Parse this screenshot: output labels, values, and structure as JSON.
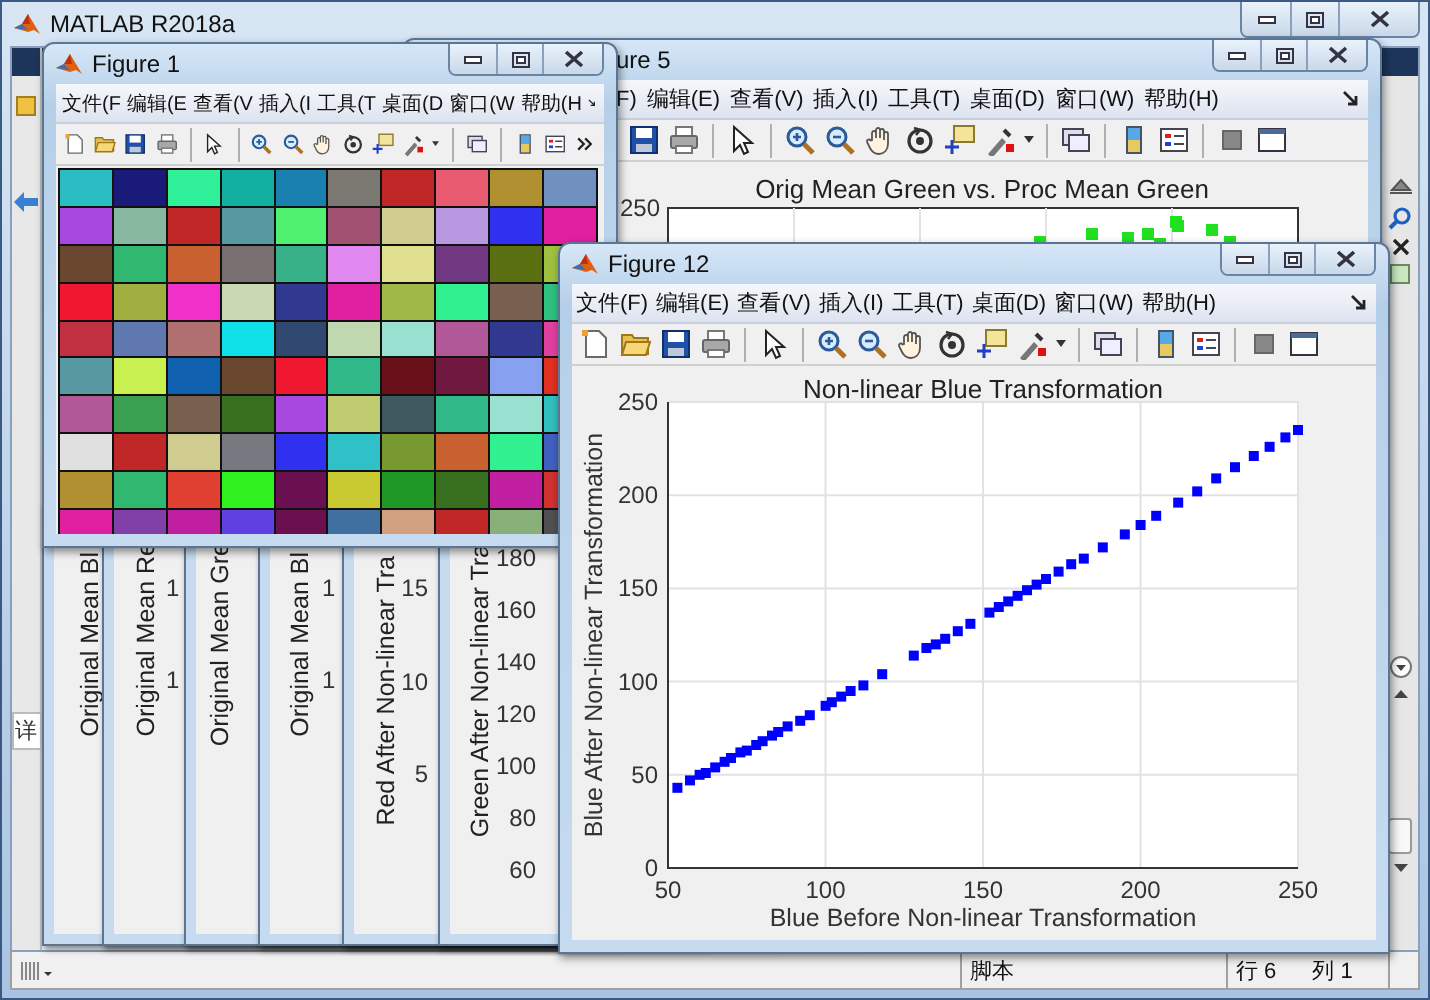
{
  "main_window": {
    "title": "MATLAB R2018a",
    "side_tab": "详"
  },
  "figure_5": {
    "title": "ure 5",
    "menus": [
      "F)",
      "编辑(E)",
      "查看(V)",
      "插入(I)",
      "工具(T)",
      "桌面(D)",
      "窗口(W)",
      "帮助(H)"
    ],
    "chart": {
      "title": "Orig Mean Green vs. Proc Mean Green",
      "ytick": "250"
    }
  },
  "stacked_figures": [
    {
      "ylabel": "Original Mean Bl"
    },
    {
      "ylabel": "Original Mean Re",
      "yticks": [
        "1",
        "1"
      ]
    },
    {
      "ylabel": "Original Mean Gre"
    },
    {
      "ylabel": "Original Mean Bl",
      "yticks": [
        "1",
        "1"
      ]
    },
    {
      "ylabel": "Red After Non-linear Tra",
      "yticks": [
        "15",
        "10",
        "5"
      ]
    },
    {
      "ylabel": "Green After Non-linear Tra",
      "yticks": [
        "180",
        "160",
        "140",
        "120",
        "100",
        "80",
        "60"
      ]
    }
  ],
  "figure_1": {
    "title": "Figure 1",
    "menus": [
      "文件(F",
      "编辑(E",
      "查看(V",
      "插入(I",
      "工具(T",
      "桌面(D",
      "窗口(W",
      "帮助(H"
    ],
    "patches": [
      {
        "cells": [
          {
            "color": "#2bbcc4"
          },
          {
            "color": "#1a1a7a"
          },
          {
            "color": "#30f09a"
          },
          {
            "color": "#12b0a0"
          },
          {
            "color": "#1a80b0"
          },
          {
            "color": "#7a7870"
          },
          {
            "color": "#c02828"
          },
          {
            "color": "#e85a70"
          },
          {
            "color": "#b09030"
          },
          {
            "color": "#7090c0"
          }
        ]
      },
      {
        "cells": [
          {
            "color": "#a848e0"
          },
          {
            "color": "#88b8a0"
          },
          {
            "color": "#c02828"
          },
          {
            "color": "#5898a0"
          },
          {
            "color": "#50f070"
          },
          {
            "color": "#a05070"
          },
          {
            "color": "#d0cc90"
          },
          {
            "color": "#b898e0"
          },
          {
            "color": "#3030f0"
          },
          {
            "color": "#e020a0"
          }
        ]
      },
      {
        "cells": [
          {
            "color": "#6a4830"
          },
          {
            "color": "#30b870"
          },
          {
            "color": "#c86030"
          },
          {
            "color": "#787070"
          },
          {
            "color": "#38b088"
          },
          {
            "color": "#e088f0"
          },
          {
            "color": "#e0e090"
          },
          {
            "color": "#703880"
          },
          {
            "color": "#5a7010"
          },
          {
            "color": "#a0c040"
          }
        ]
      },
      {
        "cells": [
          {
            "color": "#f01830"
          },
          {
            "color": "#a0b040"
          },
          {
            "color": "#f030c8"
          },
          {
            "color": "#c8d8b0"
          },
          {
            "color": "#303890"
          },
          {
            "color": "#e020a0"
          },
          {
            "color": "#a0b848"
          },
          {
            "color": "#30f090"
          },
          {
            "color": "#786050"
          },
          {
            "color": "#30c080"
          }
        ]
      },
      {
        "cells": [
          {
            "color": "#c03040"
          },
          {
            "color": "#6078b0"
          },
          {
            "color": "#b07070"
          },
          {
            "color": "#10e0e8"
          },
          {
            "color": "#304870"
          },
          {
            "color": "#c0d8b0"
          },
          {
            "color": "#98e0d0"
          },
          {
            "color": "#b05898"
          },
          {
            "color": "#303890"
          },
          {
            "color": "#e040a0"
          }
        ]
      },
      {
        "cells": [
          {
            "color": "#5898a0"
          },
          {
            "color": "#c8f050"
          },
          {
            "color": "#1060b0"
          },
          {
            "color": "#6a4830"
          },
          {
            "color": "#f01830"
          },
          {
            "color": "#30b888"
          },
          {
            "color": "#6a1018"
          },
          {
            "color": "#701840"
          },
          {
            "color": "#88a0f0"
          },
          {
            "color": "#e03020"
          }
        ]
      },
      {
        "cells": [
          {
            "color": "#b05898"
          },
          {
            "color": "#38a050"
          },
          {
            "color": "#786050"
          },
          {
            "color": "#387020"
          },
          {
            "color": "#a848e0"
          },
          {
            "color": "#c0cc70"
          },
          {
            "color": "#405860"
          },
          {
            "color": "#30b888"
          },
          {
            "color": "#98e0d0"
          },
          {
            "color": "#30c0c0"
          }
        ]
      },
      {
        "cells": [
          {
            "color": "#e0e0e0"
          },
          {
            "color": "#c02828"
          },
          {
            "color": "#d0cc90"
          },
          {
            "color": "#787880"
          },
          {
            "color": "#3030f0"
          },
          {
            "color": "#30c0c8"
          },
          {
            "color": "#789830"
          },
          {
            "color": "#c86030"
          },
          {
            "color": "#30f090"
          },
          {
            "color": "#4060c0"
          }
        ]
      },
      {
        "cells": [
          {
            "color": "#b09030"
          },
          {
            "color": "#30b870"
          },
          {
            "color": "#e04030"
          },
          {
            "color": "#30f020"
          },
          {
            "color": "#6a1050"
          },
          {
            "color": "#c8c830"
          },
          {
            "color": "#209828"
          },
          {
            "color": "#387020"
          },
          {
            "color": "#c020a0"
          },
          {
            "color": "#d03030"
          }
        ]
      },
      {
        "cells": [
          {
            "color": "#e020a0"
          },
          {
            "color": "#8040a8"
          },
          {
            "color": "#c020a0"
          },
          {
            "color": "#6040e0"
          },
          {
            "color": "#6a1050"
          },
          {
            "color": "#4070a0"
          },
          {
            "color": "#d0a080"
          },
          {
            "color": "#c02828"
          },
          {
            "color": "#88b078"
          },
          {
            "color": "#505050"
          }
        ]
      }
    ]
  },
  "figure_12": {
    "title": "Figure 12",
    "menus": [
      "文件(F)",
      "编辑(E)",
      "查看(V)",
      "插入(I)",
      "工具(T)",
      "桌面(D)",
      "窗口(W)",
      "帮助(H)"
    ],
    "chart_data": {
      "type": "scatter",
      "title": "Non-linear Blue Transformation",
      "xlabel": "Blue Before Non-linear Transformation",
      "ylabel": "Blue After Non-linear Transformation",
      "x": [
        53,
        57,
        60,
        62,
        65,
        68,
        70,
        73,
        75,
        78,
        80,
        83,
        85,
        88,
        92,
        95,
        100,
        102,
        105,
        108,
        112,
        118,
        128,
        132,
        135,
        138,
        142,
        146,
        152,
        155,
        158,
        161,
        164,
        167,
        170,
        174,
        178,
        182,
        188,
        195,
        200,
        205,
        212,
        218,
        224,
        230,
        236,
        241,
        246,
        250
      ],
      "series": [
        {
          "color": "#0000ff",
          "values": [
            43,
            47,
            50,
            51,
            54,
            57,
            59,
            62,
            63,
            66,
            68,
            71,
            73,
            76,
            79,
            82,
            87,
            89,
            92,
            95,
            98,
            104,
            114,
            118,
            120,
            123,
            127,
            131,
            137,
            140,
            143,
            146,
            149,
            152,
            155,
            159,
            163,
            166,
            172,
            179,
            184,
            189,
            196,
            202,
            209,
            215,
            221,
            226,
            231,
            235
          ]
        }
      ],
      "grid": true,
      "xlim": [
        50,
        250
      ],
      "ylim": [
        0,
        250
      ],
      "xticks": [
        50,
        100,
        150,
        200,
        250
      ],
      "yticks": [
        0,
        50,
        100,
        150,
        200,
        250
      ]
    }
  },
  "status_bar": {
    "mode": "脚本",
    "line": "行 6",
    "column": "列 1"
  }
}
